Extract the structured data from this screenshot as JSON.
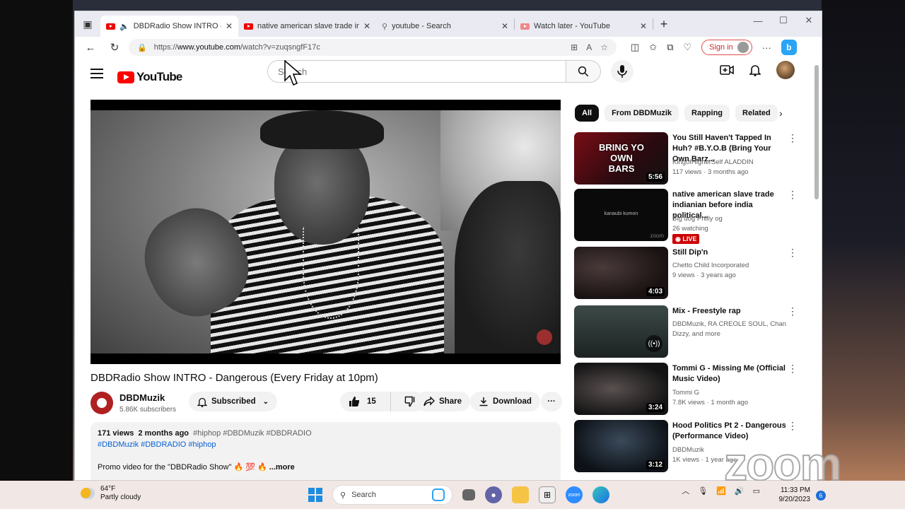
{
  "browser": {
    "tabs": [
      {
        "title": "DBDRadio Show INTRO - Dangerous",
        "active": true
      },
      {
        "title": "native american slave trade indianian",
        "active": false
      },
      {
        "title": "youtube - Search",
        "active": false
      },
      {
        "title": "Watch later - YouTube",
        "active": false
      }
    ],
    "url_prefix": "https://",
    "url_host": "www.youtube.com",
    "url_path": "/watch?v=zuqsngfF17c",
    "sign_in": "Sign in"
  },
  "youtube": {
    "logo_text": "YouTube",
    "search_placeholder": "Search",
    "video": {
      "title": "DBDRadio Show INTRO - Dangerous (Every Friday at 10pm)",
      "channel": "DBDMuzik",
      "subscribers": "5.86K subscribers",
      "subscribed_label": "Subscribed",
      "likes": "15",
      "share_label": "Share",
      "download_label": "Download"
    },
    "description": {
      "views": "171 views",
      "age": "2 months ago",
      "hashtags_inline": "#hiphop #DBDMuzik #DBDRADIO",
      "tags": "#DBDMuzik #DBDRADIO #hiphop",
      "text": "Promo video for the \"DBDRadio Show\" 🔥 💯 🔥",
      "more": "...more"
    },
    "chips": [
      "All",
      "From DBDMuzik",
      "Rapping",
      "Related"
    ],
    "recommendations": [
      {
        "title": "You Still Haven't Tapped In Huh? #B.Y.O.B (Bring Your Own Barz...",
        "channel": "King0fHigherSelf ALADDIN",
        "meta": "117 views · 3 months ago",
        "duration": "5:56",
        "thumb_caption": "BRING YO OWN BARS"
      },
      {
        "title": "native american slave trade indianian before india political...",
        "channel": "Big dog Philly og",
        "meta": "26 watching",
        "live": "LIVE",
        "thumb_caption": "kanaubi kumon",
        "thumb_brand": "zoom"
      },
      {
        "title": "Still Dip'n",
        "channel": "Chetto Child Incorporated",
        "meta": "9 views · 3 years ago",
        "duration": "4:03"
      },
      {
        "title": "Mix - Freestyle rap",
        "channel": "DBDMuzik, RA CREOLE SOUL, Chan Dizzy, and more",
        "meta": ""
      },
      {
        "title": "Tommi G - Missing Me (Official Music Video)",
        "channel": "Tommi G",
        "meta": "7.8K views · 1 month ago",
        "duration": "3:24"
      },
      {
        "title": "Hood Politics Pt 2 - Dangerous (Performance Video)",
        "channel": "DBDMuzik",
        "meta": "1K views · 1 year ago",
        "duration": "3:12"
      }
    ]
  },
  "overlay": {
    "zoom_watermark": "zoom"
  },
  "taskbar": {
    "temperature": "64°F",
    "weather": "Partly cloudy",
    "search_label": "Search",
    "time": "11:33 PM",
    "date": "9/20/2023",
    "notifications": "6"
  },
  "colors": {
    "youtube_red": "#ff0000",
    "link_blue": "#065fd4",
    "live_red": "#cc0000"
  }
}
